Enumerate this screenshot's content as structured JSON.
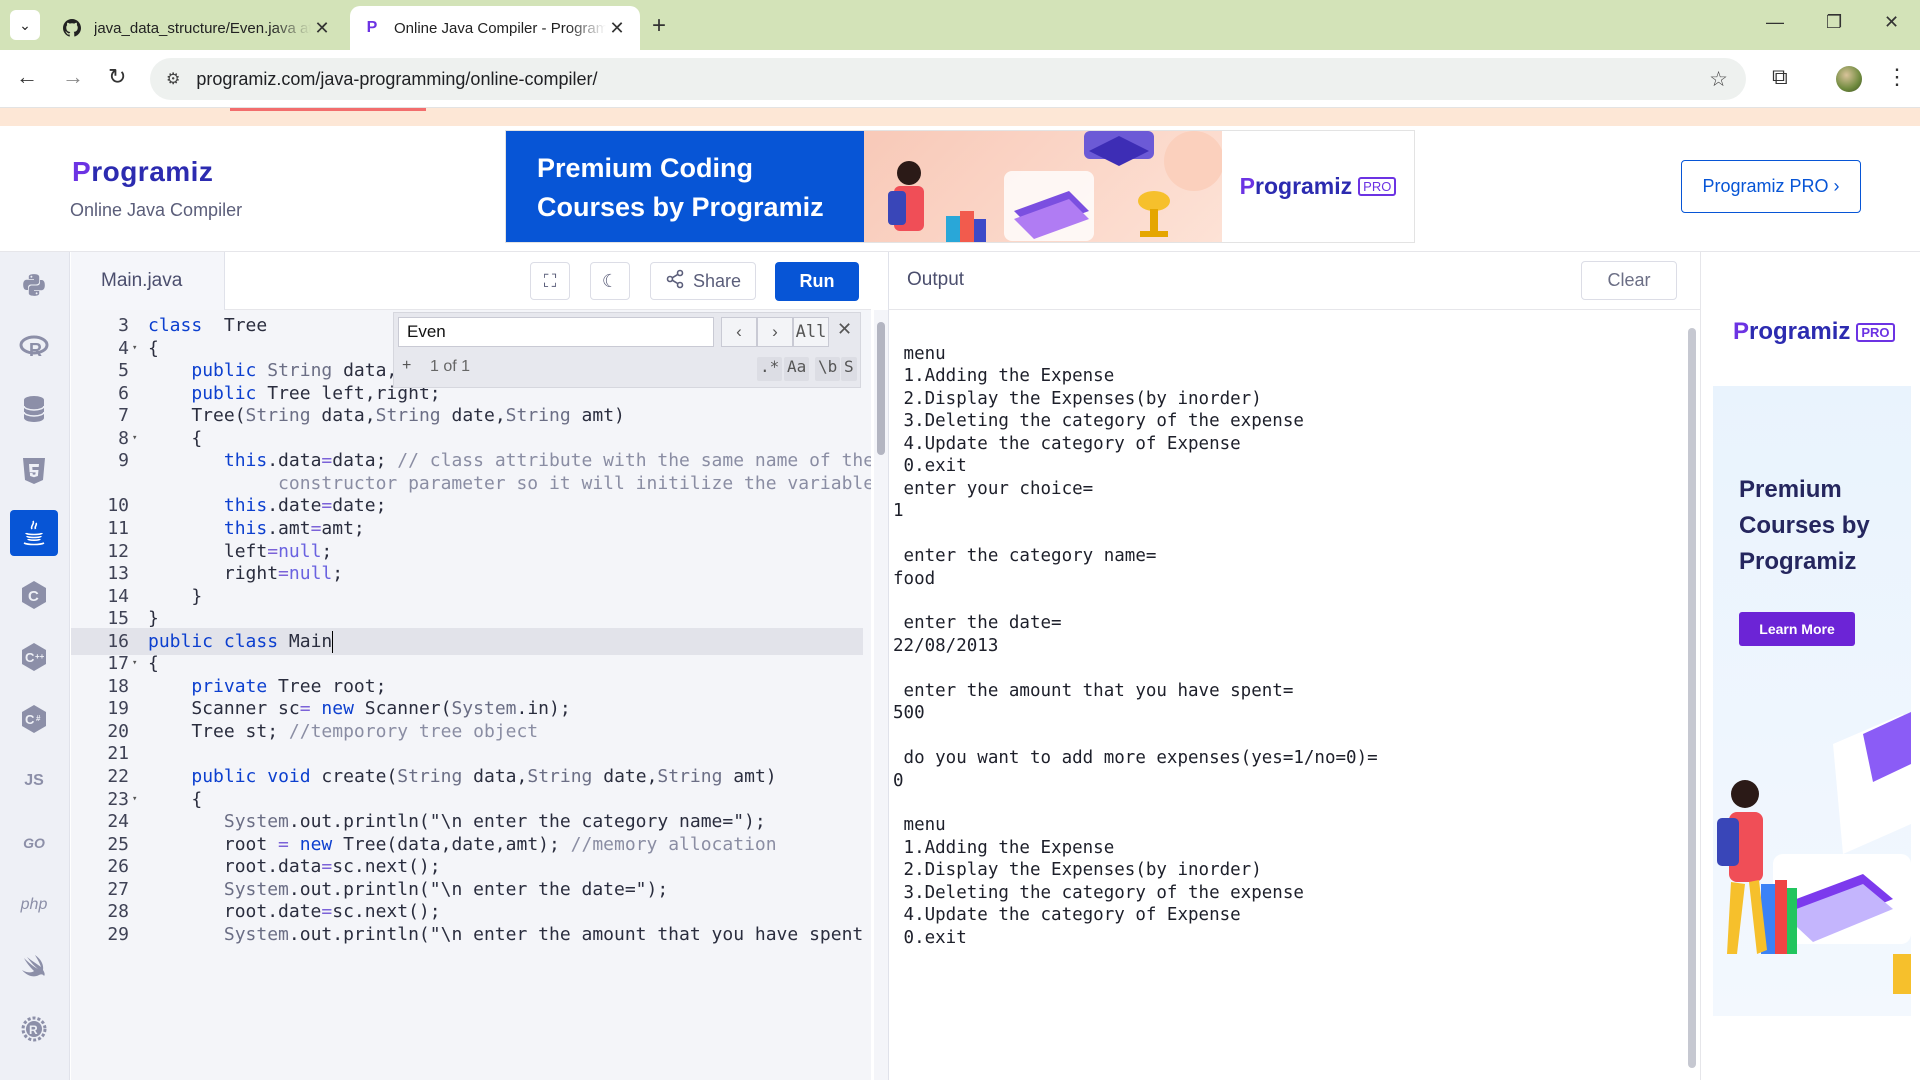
{
  "browser": {
    "tabs": [
      {
        "label": "java_data_structure/Even.java at",
        "icon": "github-icon",
        "active": false
      },
      {
        "label": "Online Java Compiler - Programiz",
        "icon": "programiz-favicon",
        "active": true
      }
    ],
    "url": "programiz.com/java-programming/online-compiler/"
  },
  "header": {
    "logo": "rogramiz",
    "logo_initial": "P",
    "subtitle": "Online Java Compiler",
    "banner": {
      "line1": "Premium Coding",
      "line2": "Courses by Programiz",
      "brand": "rogramiz",
      "brand_initial": "P",
      "badge": "PRO"
    },
    "pro_button": "Programiz PRO ›"
  },
  "languages": [
    "python",
    "r",
    "sql",
    "html",
    "java",
    "c",
    "cpp",
    "csharp",
    "JS",
    "GO",
    "php",
    "swift",
    "rust"
  ],
  "editor": {
    "file_tab": "Main.java",
    "share_label": "Share",
    "run_label": "Run",
    "find": {
      "query": "Even",
      "count": "1 of 1",
      "all_label": "All",
      "plus": "+",
      "opt_regex": ".*",
      "opt_case": "Aa",
      "opt_word": "\\b",
      "opt_sel": "S"
    },
    "lines": [
      {
        "n": "3",
        "fold": "",
        "tokens": [
          [
            "kw",
            "class"
          ],
          [
            "",
            "  Tree"
          ]
        ]
      },
      {
        "n": "4",
        "fold": "▾",
        "tokens": [
          [
            "",
            "{"
          ]
        ]
      },
      {
        "n": "5",
        "fold": "",
        "tokens": [
          [
            "",
            "    "
          ],
          [
            "kw",
            "public"
          ],
          [
            "ty",
            " String"
          ],
          [
            "",
            " data,d"
          ]
        ]
      },
      {
        "n": "6",
        "fold": "",
        "tokens": [
          [
            "",
            "    "
          ],
          [
            "kw",
            "public"
          ],
          [
            "",
            " Tree left,right;"
          ]
        ]
      },
      {
        "n": "7",
        "fold": "",
        "tokens": [
          [
            "",
            "    Tree("
          ],
          [
            "ty",
            "String"
          ],
          [
            "",
            " data,"
          ],
          [
            "ty",
            "String"
          ],
          [
            "",
            " date,"
          ],
          [
            "ty",
            "String"
          ],
          [
            "",
            " amt)"
          ]
        ]
      },
      {
        "n": "8",
        "fold": "▾",
        "tokens": [
          [
            "",
            "    {"
          ]
        ]
      },
      {
        "n": "9",
        "fold": "",
        "tokens": [
          [
            "",
            "       "
          ],
          [
            "kw",
            "this"
          ],
          [
            "",
            ".data"
          ],
          [
            "op",
            "="
          ],
          [
            "",
            "data; "
          ],
          [
            "cm",
            "// class attribute with the same name of the"
          ]
        ]
      },
      {
        "n": "",
        "fold": "",
        "tokens": [
          [
            "cm",
            "            constructor parameter so it will initilize the variables"
          ]
        ]
      },
      {
        "n": "10",
        "fold": "",
        "tokens": [
          [
            "",
            "       "
          ],
          [
            "kw",
            "this"
          ],
          [
            "",
            ".date"
          ],
          [
            "op",
            "="
          ],
          [
            "",
            "date;"
          ]
        ]
      },
      {
        "n": "11",
        "fold": "",
        "tokens": [
          [
            "",
            "       "
          ],
          [
            "kw",
            "this"
          ],
          [
            "",
            ".amt"
          ],
          [
            "op",
            "="
          ],
          [
            "",
            "amt;"
          ]
        ]
      },
      {
        "n": "12",
        "fold": "",
        "tokens": [
          [
            "",
            "       left"
          ],
          [
            "op",
            "="
          ],
          [
            "nu",
            "null"
          ],
          [
            "",
            ";"
          ]
        ]
      },
      {
        "n": "13",
        "fold": "",
        "tokens": [
          [
            "",
            "       right"
          ],
          [
            "op",
            "="
          ],
          [
            "nu",
            "null"
          ],
          [
            "",
            ";"
          ]
        ]
      },
      {
        "n": "14",
        "fold": "",
        "tokens": [
          [
            "",
            "    }"
          ]
        ]
      },
      {
        "n": "15",
        "fold": "",
        "tokens": [
          [
            "",
            "}"
          ]
        ]
      },
      {
        "n": "16",
        "fold": "",
        "tokens": [
          [
            "kw",
            "public"
          ],
          [
            "",
            " "
          ],
          [
            "kw",
            "class"
          ],
          [
            "",
            " Main"
          ]
        ],
        "current": true
      },
      {
        "n": "17",
        "fold": "▾",
        "tokens": [
          [
            "",
            "{"
          ]
        ]
      },
      {
        "n": "18",
        "fold": "",
        "tokens": [
          [
            "",
            "    "
          ],
          [
            "kw",
            "private"
          ],
          [
            "",
            " Tree root;"
          ]
        ]
      },
      {
        "n": "19",
        "fold": "",
        "tokens": [
          [
            "",
            "    Scanner sc"
          ],
          [
            "op",
            "="
          ],
          [
            "",
            " "
          ],
          [
            "kw",
            "new"
          ],
          [
            "",
            " Scanner("
          ],
          [
            "ty",
            "System"
          ],
          [
            "",
            ".in);"
          ]
        ]
      },
      {
        "n": "20",
        "fold": "",
        "tokens": [
          [
            "",
            "    Tree st; "
          ],
          [
            "cm",
            "//temporory tree object"
          ]
        ]
      },
      {
        "n": "21",
        "fold": "",
        "tokens": [
          [
            "",
            ""
          ]
        ]
      },
      {
        "n": "22",
        "fold": "",
        "tokens": [
          [
            "",
            "    "
          ],
          [
            "kw",
            "public"
          ],
          [
            "",
            " "
          ],
          [
            "kw",
            "void"
          ],
          [
            "",
            " create("
          ],
          [
            "ty",
            "String"
          ],
          [
            "",
            " data,"
          ],
          [
            "ty",
            "String"
          ],
          [
            "",
            " date,"
          ],
          [
            "ty",
            "String"
          ],
          [
            "",
            " amt)"
          ]
        ]
      },
      {
        "n": "23",
        "fold": "▾",
        "tokens": [
          [
            "",
            "    {"
          ]
        ]
      },
      {
        "n": "24",
        "fold": "",
        "tokens": [
          [
            "",
            "       "
          ],
          [
            "ty",
            "System"
          ],
          [
            "",
            ".out.println(\"\\n enter the category name=\");"
          ]
        ]
      },
      {
        "n": "25",
        "fold": "",
        "tokens": [
          [
            "",
            "       root "
          ],
          [
            "op",
            "="
          ],
          [
            "",
            " "
          ],
          [
            "kw",
            "new"
          ],
          [
            "",
            " Tree(data,date,amt); "
          ],
          [
            "cm",
            "//memory allocation"
          ]
        ]
      },
      {
        "n": "26",
        "fold": "",
        "tokens": [
          [
            "",
            "       root.data"
          ],
          [
            "op",
            "="
          ],
          [
            "",
            "sc.next();"
          ]
        ]
      },
      {
        "n": "27",
        "fold": "",
        "tokens": [
          [
            "",
            "       "
          ],
          [
            "ty",
            "System"
          ],
          [
            "",
            ".out.println(\"\\n enter the date=\");"
          ]
        ]
      },
      {
        "n": "28",
        "fold": "",
        "tokens": [
          [
            "",
            "       root.date"
          ],
          [
            "op",
            "="
          ],
          [
            "",
            "sc.next();"
          ]
        ]
      },
      {
        "n": "29",
        "fold": "",
        "tokens": [
          [
            "",
            "       "
          ],
          [
            "ty",
            "System"
          ],
          [
            "",
            ".out.println(\"\\n enter the amount that you have spent"
          ]
        ]
      }
    ]
  },
  "output": {
    "title": "Output",
    "clear_label": "Clear",
    "lines": [
      " menu",
      " 1.Adding the Expense",
      " 2.Display the Expenses(by inorder)",
      " 3.Deleting the category of the expense",
      " 4.Update the category of Expense",
      " 0.exit",
      " enter your choice=",
      "1",
      "",
      " enter the category name=",
      "food",
      "",
      " enter the date=",
      "22/08/2013",
      "",
      " enter the amount that you have spent=",
      "500",
      "",
      " do you want to add more expenses(yes=1/no=0)=",
      "0",
      "",
      " menu",
      " 1.Adding the Expense",
      " 2.Display the Expenses(by inorder)",
      " 3.Deleting the category of the expense",
      " 4.Update the category of Expense",
      " 0.exit"
    ]
  },
  "ad": {
    "brand": "rogramiz",
    "brand_initial": "P",
    "badge": "PRO",
    "line1": "Premium",
    "line2": "Courses by",
    "line3": "Programiz",
    "button": "Learn More"
  },
  "colors": {
    "accent": "#0755d6",
    "brand_purple": "#6c33e3",
    "tab_strip": "#d3e3b8"
  }
}
